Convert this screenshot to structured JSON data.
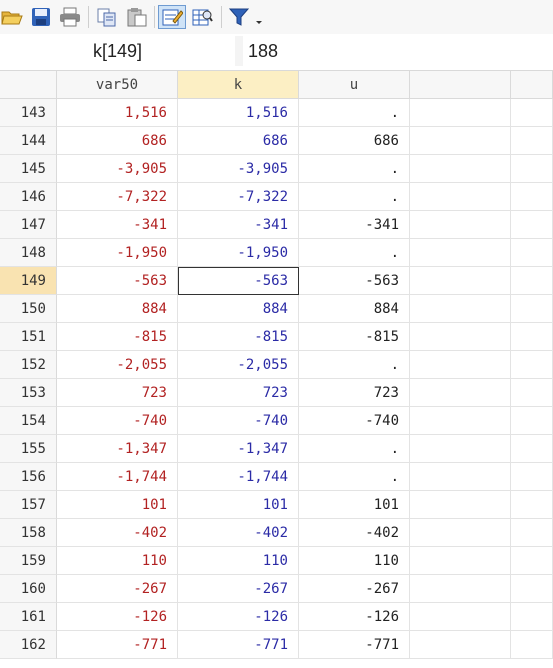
{
  "toolbar": {
    "buttons": [
      {
        "name": "open-icon"
      },
      {
        "name": "save-icon"
      },
      {
        "name": "print-icon"
      },
      {
        "name": "copy-icon"
      },
      {
        "name": "paste-icon"
      },
      {
        "name": "edit-mode-icon",
        "active": true
      },
      {
        "name": "browse-mode-icon"
      },
      {
        "name": "filter-icon"
      }
    ]
  },
  "editbar": {
    "cell_ref": "k[149]",
    "cell_value": "188"
  },
  "columns": [
    "var50",
    "k",
    "u"
  ],
  "selected": {
    "row": "149",
    "column": "k"
  },
  "rows": [
    {
      "n": "143",
      "var50": "1,516",
      "k": "1,516",
      "u": "."
    },
    {
      "n": "144",
      "var50": "686",
      "k": "686",
      "u": "686"
    },
    {
      "n": "145",
      "var50": "-3,905",
      "k": "-3,905",
      "u": "."
    },
    {
      "n": "146",
      "var50": "-7,322",
      "k": "-7,322",
      "u": "."
    },
    {
      "n": "147",
      "var50": "-341",
      "k": "-341",
      "u": "-341"
    },
    {
      "n": "148",
      "var50": "-1,950",
      "k": "-1,950",
      "u": "."
    },
    {
      "n": "149",
      "var50": "-563",
      "k": "-563",
      "u": "-563"
    },
    {
      "n": "150",
      "var50": "884",
      "k": "884",
      "u": "884"
    },
    {
      "n": "151",
      "var50": "-815",
      "k": "-815",
      "u": "-815"
    },
    {
      "n": "152",
      "var50": "-2,055",
      "k": "-2,055",
      "u": "."
    },
    {
      "n": "153",
      "var50": "723",
      "k": "723",
      "u": "723"
    },
    {
      "n": "154",
      "var50": "-740",
      "k": "-740",
      "u": "-740"
    },
    {
      "n": "155",
      "var50": "-1,347",
      "k": "-1,347",
      "u": "."
    },
    {
      "n": "156",
      "var50": "-1,744",
      "k": "-1,744",
      "u": "."
    },
    {
      "n": "157",
      "var50": "101",
      "k": "101",
      "u": "101"
    },
    {
      "n": "158",
      "var50": "-402",
      "k": "-402",
      "u": "-402"
    },
    {
      "n": "159",
      "var50": "110",
      "k": "110",
      "u": "110"
    },
    {
      "n": "160",
      "var50": "-267",
      "k": "-267",
      "u": "-267"
    },
    {
      "n": "161",
      "var50": "-126",
      "k": "-126",
      "u": "-126"
    },
    {
      "n": "162",
      "var50": "-771",
      "k": "-771",
      "u": "-771"
    }
  ],
  "colors": {
    "string_red": "#b22222",
    "number_blue": "#2b2ba6",
    "selected_header": "#fcefc4"
  }
}
